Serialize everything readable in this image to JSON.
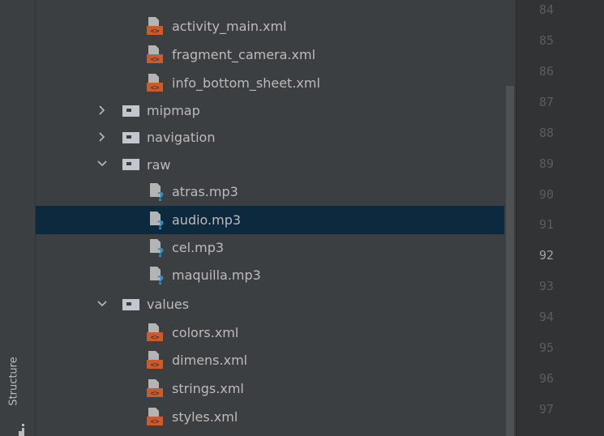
{
  "side_panel": {
    "structure_label": "Structure"
  },
  "tree": {
    "items": [
      {
        "label": "activity_main.xml",
        "type": "xml"
      },
      {
        "label": "fragment_camera.xml",
        "type": "xml"
      },
      {
        "label": "info_bottom_sheet.xml",
        "type": "xml"
      },
      {
        "label": "mipmap",
        "type": "folder",
        "expanded": false
      },
      {
        "label": "navigation",
        "type": "folder",
        "expanded": false
      },
      {
        "label": "raw",
        "type": "folder",
        "expanded": true
      },
      {
        "label": "atras.mp3",
        "type": "unknown"
      },
      {
        "label": "audio.mp3",
        "type": "unknown",
        "selected": true
      },
      {
        "label": "cel.mp3",
        "type": "unknown"
      },
      {
        "label": "maquilla.mp3",
        "type": "unknown"
      },
      {
        "label": "values",
        "type": "folder",
        "expanded": true
      },
      {
        "label": "colors.xml",
        "type": "xml"
      },
      {
        "label": "dimens.xml",
        "type": "xml"
      },
      {
        "label": "strings.xml",
        "type": "xml"
      },
      {
        "label": "styles.xml",
        "type": "xml"
      }
    ]
  },
  "gutter": {
    "line_numbers": [
      "84",
      "85",
      "86",
      "87",
      "88",
      "89",
      "90",
      "91",
      "92",
      "93",
      "94",
      "95",
      "96",
      "97"
    ],
    "current_line": "92"
  },
  "colors": {
    "panel_bg": "#3c3f41",
    "gutter_bg": "#313335",
    "selected_row": "#0d293e",
    "text": "#bbbbbb",
    "xml_icon_orange": "#c75c2e",
    "unknown_icon_blue": "#3592c4"
  },
  "icons": {
    "xml_file": "xml-file-icon",
    "folder": "folder-icon",
    "unknown_file": "unknown-file-icon",
    "chevron_right": "chevron-right-icon",
    "chevron_down": "chevron-down-icon",
    "structure": "structure-icon"
  }
}
